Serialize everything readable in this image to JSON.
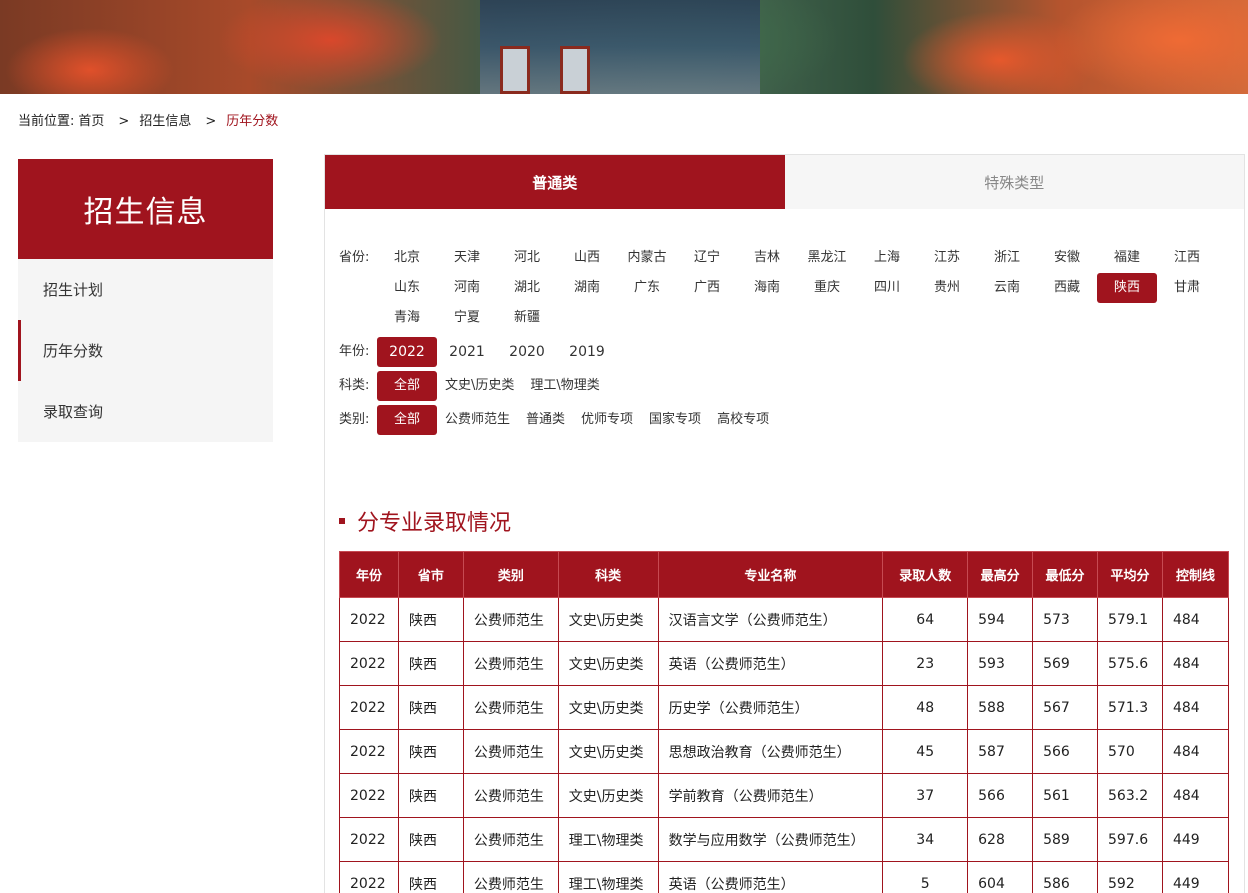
{
  "breadcrumb": {
    "prefix": "当前位置:",
    "items": [
      "首页",
      "招生信息",
      "历年分数"
    ]
  },
  "sidebar": {
    "title": "招生信息",
    "items": [
      {
        "label": "招生计划"
      },
      {
        "label": "历年分数"
      },
      {
        "label": "录取查询"
      }
    ]
  },
  "tabs": [
    {
      "label": "普通类"
    },
    {
      "label": "特殊类型"
    }
  ],
  "filters": {
    "province_label": "省份:",
    "provinces": [
      "北京",
      "天津",
      "河北",
      "山西",
      "内蒙古",
      "辽宁",
      "吉林",
      "黑龙江",
      "上海",
      "江苏",
      "浙江",
      "安徽",
      "福建",
      "江西",
      "山东",
      "河南",
      "湖北",
      "湖南",
      "广东",
      "广西",
      "海南",
      "重庆",
      "四川",
      "贵州",
      "云南",
      "西藏",
      "陕西",
      "甘肃",
      "青海",
      "宁夏",
      "新疆"
    ],
    "province_selected": "陕西",
    "year_label": "年份:",
    "years": [
      "2022",
      "2021",
      "2020",
      "2019"
    ],
    "year_selected": "2022",
    "subject_label": "科类:",
    "subjects": [
      "全部",
      "文史\\历史类",
      "理工\\物理类"
    ],
    "subject_selected": "全部",
    "category_label": "类别:",
    "categories": [
      "全部",
      "公费师范生",
      "普通类",
      "优师专项",
      "国家专项",
      "高校专项"
    ],
    "category_selected": "全部"
  },
  "section_title": "分专业录取情况",
  "table": {
    "headers": [
      "年份",
      "省市",
      "类别",
      "科类",
      "专业名称",
      "录取人数",
      "最高分",
      "最低分",
      "平均分",
      "控制线"
    ],
    "rows": [
      [
        "2022",
        "陕西",
        "公费师范生",
        "文史\\历史类",
        "汉语言文学（公费师范生）",
        "64",
        "594",
        "573",
        "579.1",
        "484"
      ],
      [
        "2022",
        "陕西",
        "公费师范生",
        "文史\\历史类",
        "英语（公费师范生）",
        "23",
        "593",
        "569",
        "575.6",
        "484"
      ],
      [
        "2022",
        "陕西",
        "公费师范生",
        "文史\\历史类",
        "历史学（公费师范生）",
        "48",
        "588",
        "567",
        "571.3",
        "484"
      ],
      [
        "2022",
        "陕西",
        "公费师范生",
        "文史\\历史类",
        "思想政治教育（公费师范生）",
        "45",
        "587",
        "566",
        "570",
        "484"
      ],
      [
        "2022",
        "陕西",
        "公费师范生",
        "文史\\历史类",
        "学前教育（公费师范生）",
        "37",
        "566",
        "561",
        "563.2",
        "484"
      ],
      [
        "2022",
        "陕西",
        "公费师范生",
        "理工\\物理类",
        "数学与应用数学（公费师范生）",
        "34",
        "628",
        "589",
        "597.6",
        "449"
      ],
      [
        "2022",
        "陕西",
        "公费师范生",
        "理工\\物理类",
        "英语（公费师范生）",
        "5",
        "604",
        "586",
        "592",
        "449"
      ]
    ]
  },
  "colors": {
    "accent": "#a0141e"
  }
}
